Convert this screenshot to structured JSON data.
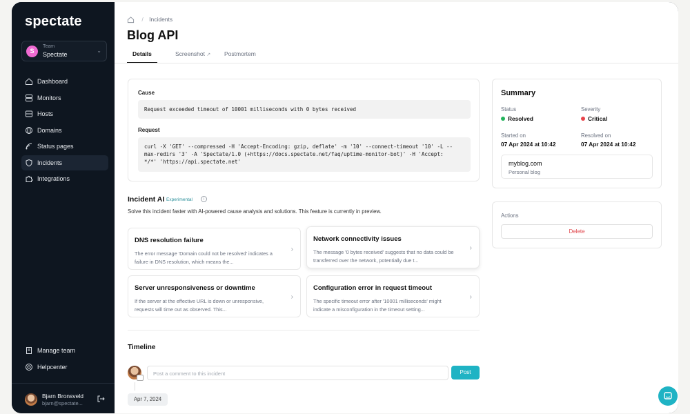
{
  "app": {
    "logo": "spectate"
  },
  "team": {
    "label": "Team",
    "name": "Spectate",
    "initial": "S"
  },
  "nav": {
    "items": [
      {
        "label": "Dashboard",
        "icon": "home-icon"
      },
      {
        "label": "Monitors",
        "icon": "server-icon"
      },
      {
        "label": "Hosts",
        "icon": "hosts-icon"
      },
      {
        "label": "Domains",
        "icon": "globe-icon"
      },
      {
        "label": "Status pages",
        "icon": "signal-icon"
      },
      {
        "label": "Incidents",
        "icon": "shield-icon",
        "active": true
      },
      {
        "label": "Integrations",
        "icon": "puzzle-icon"
      }
    ],
    "bottom": [
      {
        "label": "Manage team",
        "icon": "building-icon"
      },
      {
        "label": "Helpcenter",
        "icon": "lifebuoy-icon"
      }
    ]
  },
  "user": {
    "name": "Bjarn Bronsveld",
    "email": "bjarn@spectate..."
  },
  "breadcrumb": {
    "section": "Incidents"
  },
  "page": {
    "title": "Blog API"
  },
  "tabs": [
    {
      "label": "Details",
      "active": true
    },
    {
      "label": "Screenshot"
    },
    {
      "label": "Postmortem"
    }
  ],
  "cause": {
    "label": "Cause",
    "text": "Request exceeded timeout of 10001 milliseconds with 0 bytes received",
    "request_label": "Request",
    "request_lines": [
      "curl -X 'GET' --compressed -H 'Accept-Encoding: gzip, deflate' -m '10' --connect-timeout '10' -L --",
      "max-redirs '3' -A 'Spectate/1.0 (+https://docs.spectate.net/faq/uptime-monitor-bot)' -H 'Accept:",
      "*/*' 'https://api.spectate.net'"
    ]
  },
  "ai": {
    "title": "Incident AI",
    "badge": "Experimental",
    "description": "Solve this incident faster with AI-powered cause analysis and solutions. This feature is currently in preview.",
    "cards": [
      {
        "title": "DNS resolution failure",
        "desc": "The error message 'Domain could not be resolved' indicates a failure in DNS resolution, which means the..."
      },
      {
        "title": "Network connectivity issues",
        "desc": "The message '0 bytes received' suggests that no data could be transferred over the network, potentially due t..."
      },
      {
        "title": "Server unresponsiveness or downtime",
        "desc": "If the server at the effective URL is down or unresponsive, requests will time out as observed. This..."
      },
      {
        "title": "Configuration error in request timeout",
        "desc": "The specific timeout error after '10001 milliseconds' might indicate a misconfiguration in the timeout setting..."
      }
    ]
  },
  "timeline": {
    "title": "Timeline",
    "comment_placeholder": "Post a comment to this incident",
    "post_label": "Post",
    "date": "Apr 7, 2024"
  },
  "summary": {
    "title": "Summary",
    "status_label": "Status",
    "status": "Resolved",
    "status_color": "#22b35b",
    "severity_label": "Severity",
    "severity": "Critical",
    "severity_color": "#e8434a",
    "started_label": "Started on",
    "started": "07 Apr 2024 at 10:42",
    "resolved_label": "Resolved on",
    "resolved": "07 Apr 2024 at 10:42",
    "site_name": "myblog.com",
    "site_desc": "Personal blog"
  },
  "actions": {
    "label": "Actions",
    "delete_label": "Delete"
  },
  "colors": {
    "accent": "#1fb3c4",
    "sidebar": "#0e1620",
    "danger": "#e0474c"
  }
}
